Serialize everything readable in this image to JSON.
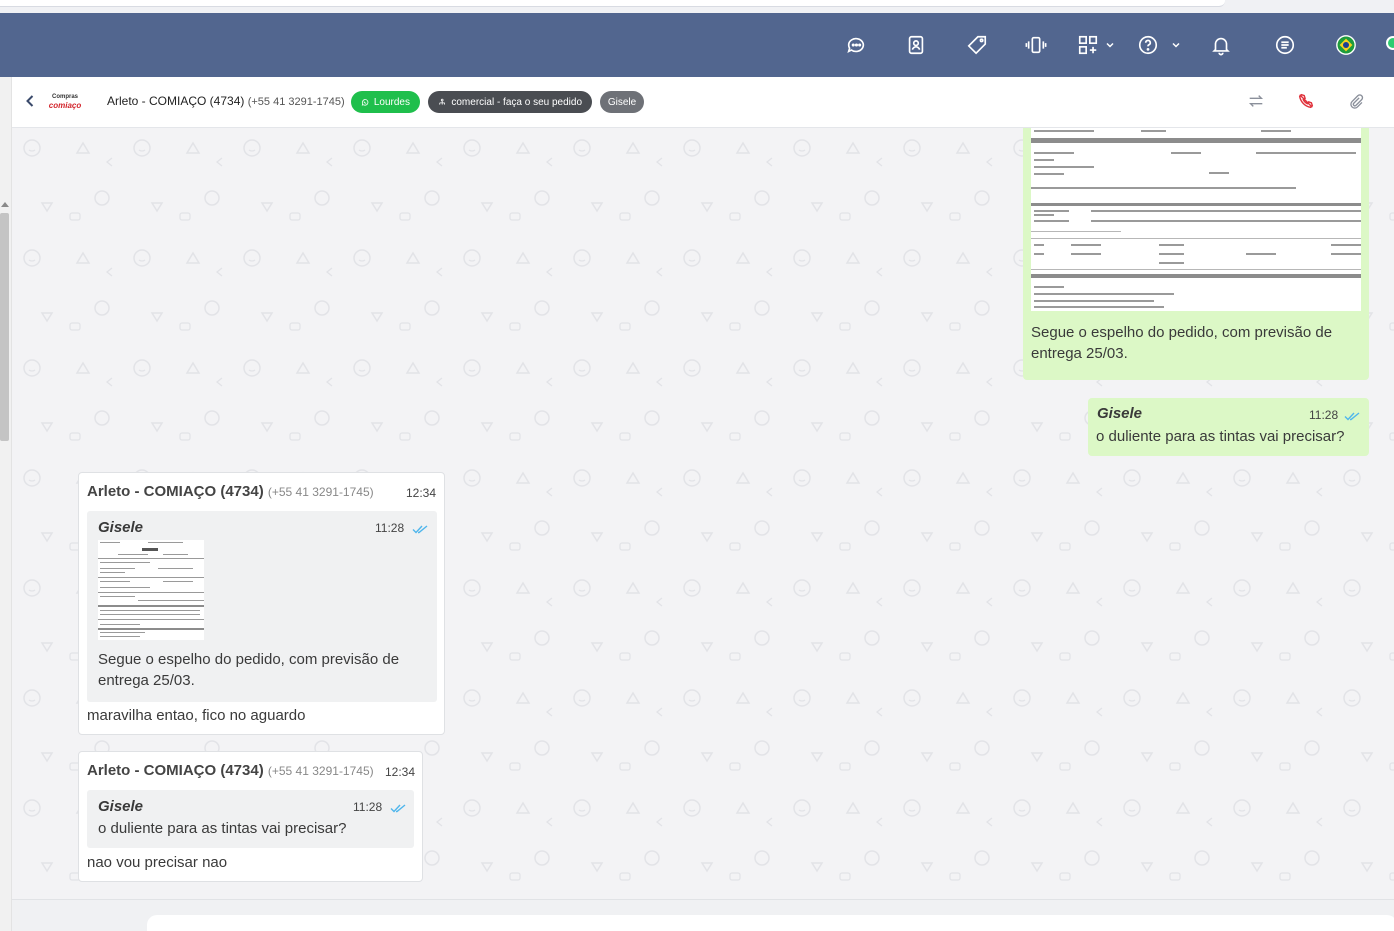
{
  "topbar": {
    "icons": [
      "chat-icon",
      "contacts-icon",
      "tag-icon",
      "phone-vibrate-icon",
      "apps-grid-icon",
      "help-icon",
      "bell-icon",
      "list-icon",
      "brazil-flag-icon"
    ],
    "bg_color": "#52668f"
  },
  "header": {
    "contact_name": "Arleto - COMIAÇO (4734)",
    "contact_phone": "(+55 41 3291-1745)",
    "logo_line1": "Compras",
    "logo_line2": "comiaço",
    "badge_channel": "Lourdes",
    "badge_sector": "comercial - faça o seu pedido",
    "badge_user": "Gisele",
    "colors": {
      "channel": "#1fbf4c",
      "sector": "#4a4d52",
      "user": "#6e7177"
    }
  },
  "messages": {
    "out1": {
      "caption": "Segue o espelho do pedido, com previsão de entrega 25/03."
    },
    "out2": {
      "sender": "Gisele",
      "time": "11:28",
      "text": "o duliente para as tintas vai precisar?"
    },
    "in1": {
      "author": "Arleto - COMIAÇO (4734)",
      "phone": "(+55 41 3291-1745)",
      "time": "12:34",
      "quote": {
        "sender": "Gisele",
        "time": "11:28",
        "text": "Segue o espelho do pedido, com previsão de entrega 25/03."
      },
      "text": "maravilha entao, fico no aguardo"
    },
    "in2": {
      "author": "Arleto - COMIAÇO (4734)",
      "phone": "(+55 41 3291-1745)",
      "time": "12:34",
      "quote": {
        "sender": "Gisele",
        "time": "11:28",
        "text": "o duliente para as tintas vai precisar?"
      },
      "text": "nao vou precisar nao"
    }
  },
  "colors": {
    "outgoing": "#dcf8c6",
    "incoming": "#ffffff",
    "tick": "#4fb6ec"
  }
}
